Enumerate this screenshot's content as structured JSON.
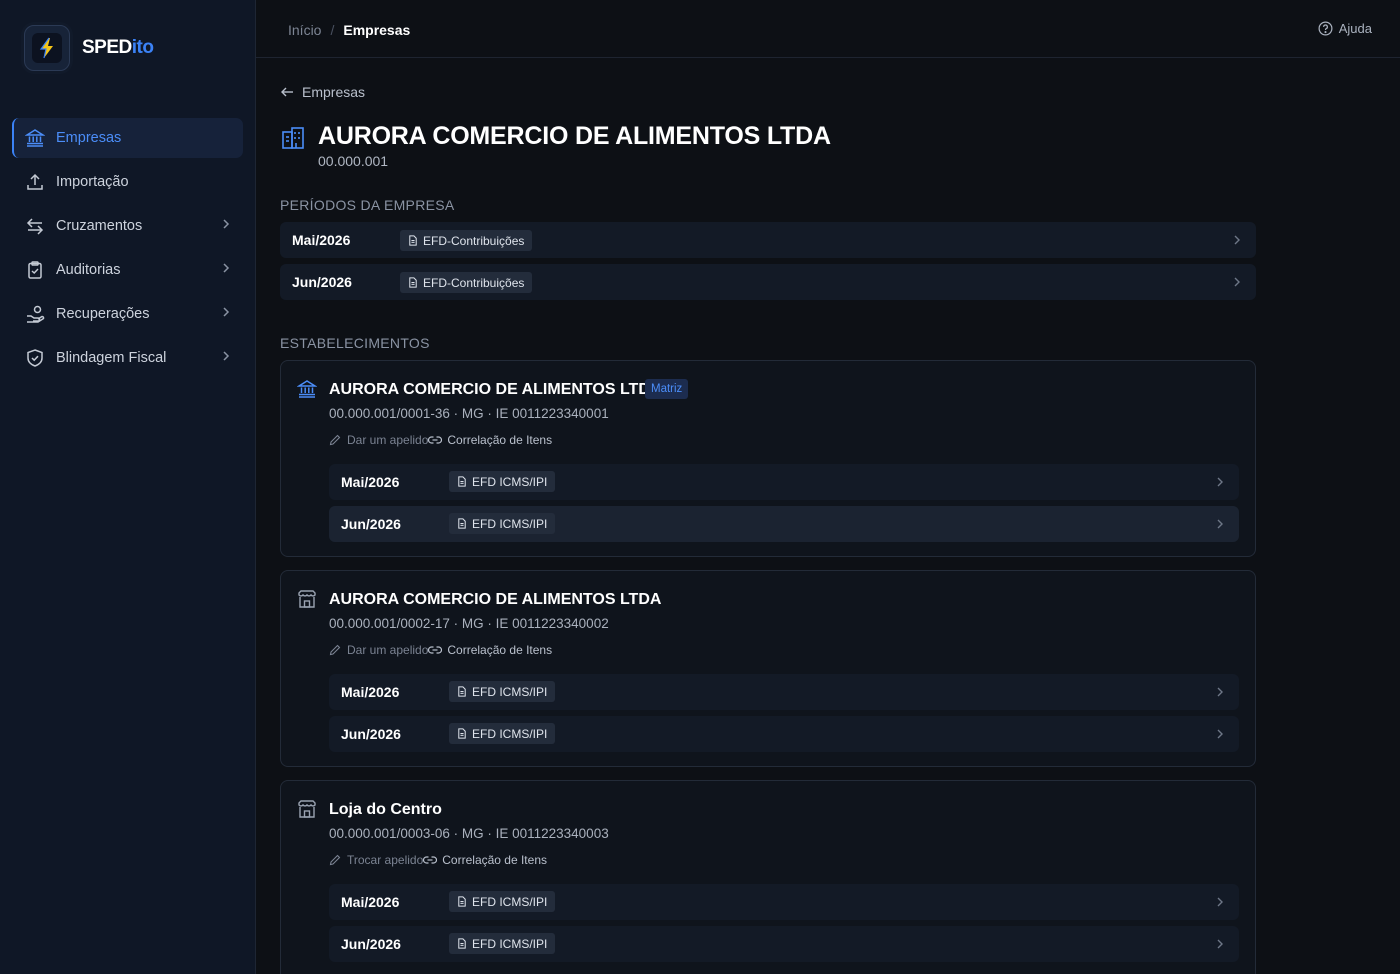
{
  "app": {
    "logo_text_a": "SPED",
    "logo_text_b": "ito",
    "accent": "#3b82f6"
  },
  "sidebar": {
    "items": [
      {
        "label": "Empresas",
        "icon": "bank-icon",
        "active": true
      },
      {
        "label": "Importação",
        "icon": "upload-icon"
      },
      {
        "label": "Cruzamentos",
        "icon": "arrows-exchange-icon"
      },
      {
        "label": "Auditorias",
        "icon": "clipboard-check-icon"
      },
      {
        "label": "Recuperações",
        "icon": "hand-coins-icon"
      },
      {
        "label": "Blindagem Fiscal",
        "icon": "shield-check-icon"
      }
    ]
  },
  "topbar": {
    "breadcrumb_home": "Início",
    "breadcrumb_sep": "/",
    "breadcrumb_current": "Empresas",
    "help_label": "Ajuda"
  },
  "main": {
    "back_label": "Empresas",
    "company_name": "AURORA COMERCIO DE ALIMENTOS LTDA",
    "company_code": "00.000.001",
    "periods_label": "PERÍODOS DA EMPRESA",
    "periods": [
      {
        "name": "Mai/2026",
        "tag": "EFD-Contribuições"
      },
      {
        "name": "Jun/2026",
        "tag": "EFD-Contribuições"
      }
    ],
    "estab_label": "ESTABELECIMENTOS",
    "establishments": [
      {
        "name": "AURORA COMERCIO DE ALIMENTOS LTDA",
        "badge": "Matriz",
        "info": "00.000.001/0001-36 · MG · IE 0011223340001",
        "nick_action": "Dar um apelido",
        "corr_action": "Correlação de Itens",
        "periods": [
          {
            "name": "Mai/2026",
            "tag": "EFD ICMS/IPI"
          },
          {
            "name": "Jun/2026",
            "tag": "EFD ICMS/IPI"
          }
        ]
      },
      {
        "name": "AURORA COMERCIO DE ALIMENTOS LTDA",
        "info": "00.000.001/0002-17 · MG · IE 0011223340002",
        "nick_action": "Dar um apelido",
        "corr_action": "Correlação de Itens",
        "periods": [
          {
            "name": "Mai/2026",
            "tag": "EFD ICMS/IPI"
          },
          {
            "name": "Jun/2026",
            "tag": "EFD ICMS/IPI"
          }
        ]
      },
      {
        "name": "Loja do Centro",
        "info": "00.000.001/0003-06 · MG · IE 0011223340003",
        "nick_action": "Trocar apelido",
        "corr_action": "Correlação de Itens",
        "periods": [
          {
            "name": "Mai/2026",
            "tag": "EFD ICMS/IPI"
          },
          {
            "name": "Jun/2026",
            "tag": "EFD ICMS/IPI"
          }
        ]
      }
    ]
  }
}
